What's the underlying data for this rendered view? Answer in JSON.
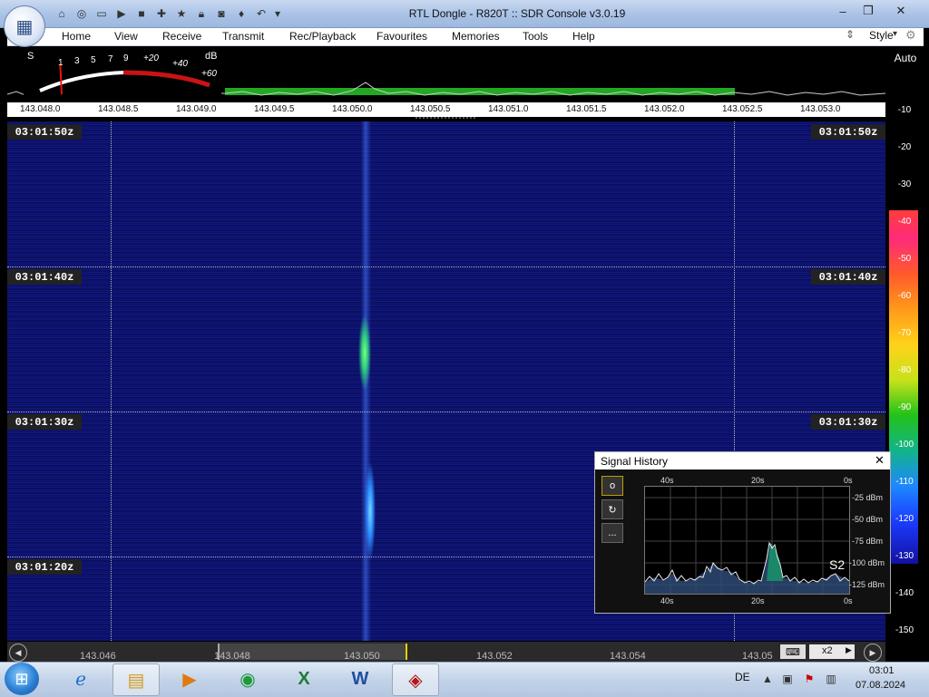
{
  "window": {
    "title": "RTL Dongle - R820T :: SDR Console v3.0.19"
  },
  "menu": {
    "items": [
      "Home",
      "View",
      "Receive",
      "Transmit",
      "Rec/Playback",
      "Favourites",
      "Memories",
      "Tools",
      "Help"
    ],
    "style_label": "Style"
  },
  "smeter": {
    "s_label": "S",
    "db_label": "dB",
    "s_scale": [
      "1",
      "3",
      "5",
      "7",
      "9"
    ],
    "plus_scale": [
      "+20",
      "+40",
      "+60"
    ],
    "reading_fraction": 0.12
  },
  "spectrum": {
    "auto_label": "Auto",
    "freq_ticks": [
      "143.048.0",
      "143.048.5",
      "143.049.0",
      "143.049.5",
      "143.050.0",
      "143.050.5",
      "143.051.0",
      "143.051.5",
      "143.052.0",
      "143.052.5",
      "143.053.0"
    ],
    "db_ticks": [
      "-10",
      "-20",
      "-30",
      "-40",
      "-50",
      "-60",
      "-70",
      "-80",
      "-90",
      "-100",
      "-110",
      "-120",
      "-130",
      "-140",
      "-150"
    ]
  },
  "waterfall": {
    "timestamps": [
      "03:01:50z",
      "03:01:40z",
      "03:01:30z",
      "03:01:20z"
    ]
  },
  "bottom_scale": {
    "freqs": [
      "143.046",
      "143.048",
      "143.050",
      "143.052",
      "143.054",
      "143.05"
    ],
    "zoom_label": "x2"
  },
  "signal_history": {
    "title": "Signal History",
    "close_glyph": "✕",
    "top_labels": [
      "40s",
      "20s",
      "0s"
    ],
    "bottom_labels": [
      "40s",
      "20s",
      "0s"
    ],
    "y_labels": [
      "-25 dBm",
      "-50 dBm",
      "-75 dBm",
      "-100 dBm",
      "-125 dBm"
    ],
    "s_reading": "S2",
    "buttons": [
      "o",
      "↻",
      "..."
    ]
  },
  "taskbar": {
    "apps": [
      "internet-explorer",
      "explorer",
      "media-player",
      "chrome",
      "excel",
      "word",
      "sdr-console"
    ],
    "language": "DE",
    "time": "03:01",
    "date": "07.08.2024"
  }
}
